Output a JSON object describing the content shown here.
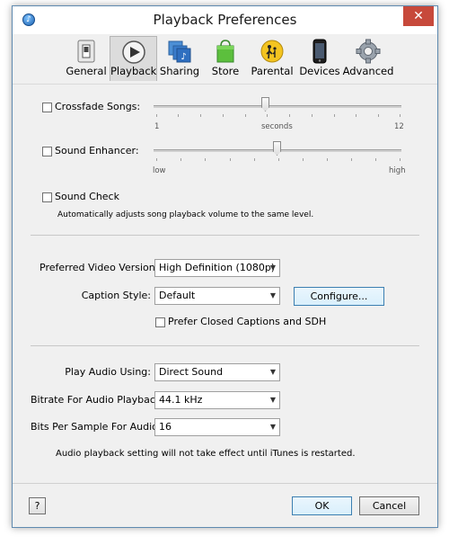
{
  "window": {
    "title": "Playback Preferences",
    "close_glyph": "✕",
    "app_icon": "itunes-icon"
  },
  "tabs": [
    {
      "label": "General",
      "icon": "general-switch-icon"
    },
    {
      "label": "Playback",
      "icon": "play-icon",
      "active": true
    },
    {
      "label": "Sharing",
      "icon": "sharing-icon"
    },
    {
      "label": "Store",
      "icon": "store-bag-icon"
    },
    {
      "label": "Parental",
      "icon": "parental-icon"
    },
    {
      "label": "Devices",
      "icon": "device-phone-icon"
    },
    {
      "label": "Advanced",
      "icon": "gear-icon"
    }
  ],
  "crossfade": {
    "label": "Crossfade Songs:",
    "checked": false,
    "min_label": "1",
    "mid_label": "seconds",
    "max_label": "12",
    "value": 6
  },
  "enhancer": {
    "label": "Sound Enhancer:",
    "checked": false,
    "min_label": "low",
    "max_label": "high",
    "value": 0.5
  },
  "sound_check": {
    "label": "Sound Check",
    "checked": false,
    "note": "Automatically adjusts song playback volume to the same level."
  },
  "video": {
    "preferred_label": "Preferred Video Version:",
    "preferred_value": "High Definition (1080p)",
    "caption_label": "Caption Style:",
    "caption_value": "Default",
    "configure_label": "Configure...",
    "closed_captions_label": "Prefer Closed Captions and SDH",
    "closed_captions_checked": false
  },
  "audio": {
    "play_using_label": "Play Audio Using:",
    "play_using_value": "Direct Sound",
    "bitrate_label": "Bitrate For Audio Playback:",
    "bitrate_value": "44.1 kHz",
    "bits_label": "Bits Per Sample For Audio",
    "bits_value": "16",
    "note": "Audio playback setting will not take effect until iTunes is restarted."
  },
  "footer": {
    "help_label": "?",
    "ok_label": "OK",
    "cancel_label": "Cancel"
  }
}
